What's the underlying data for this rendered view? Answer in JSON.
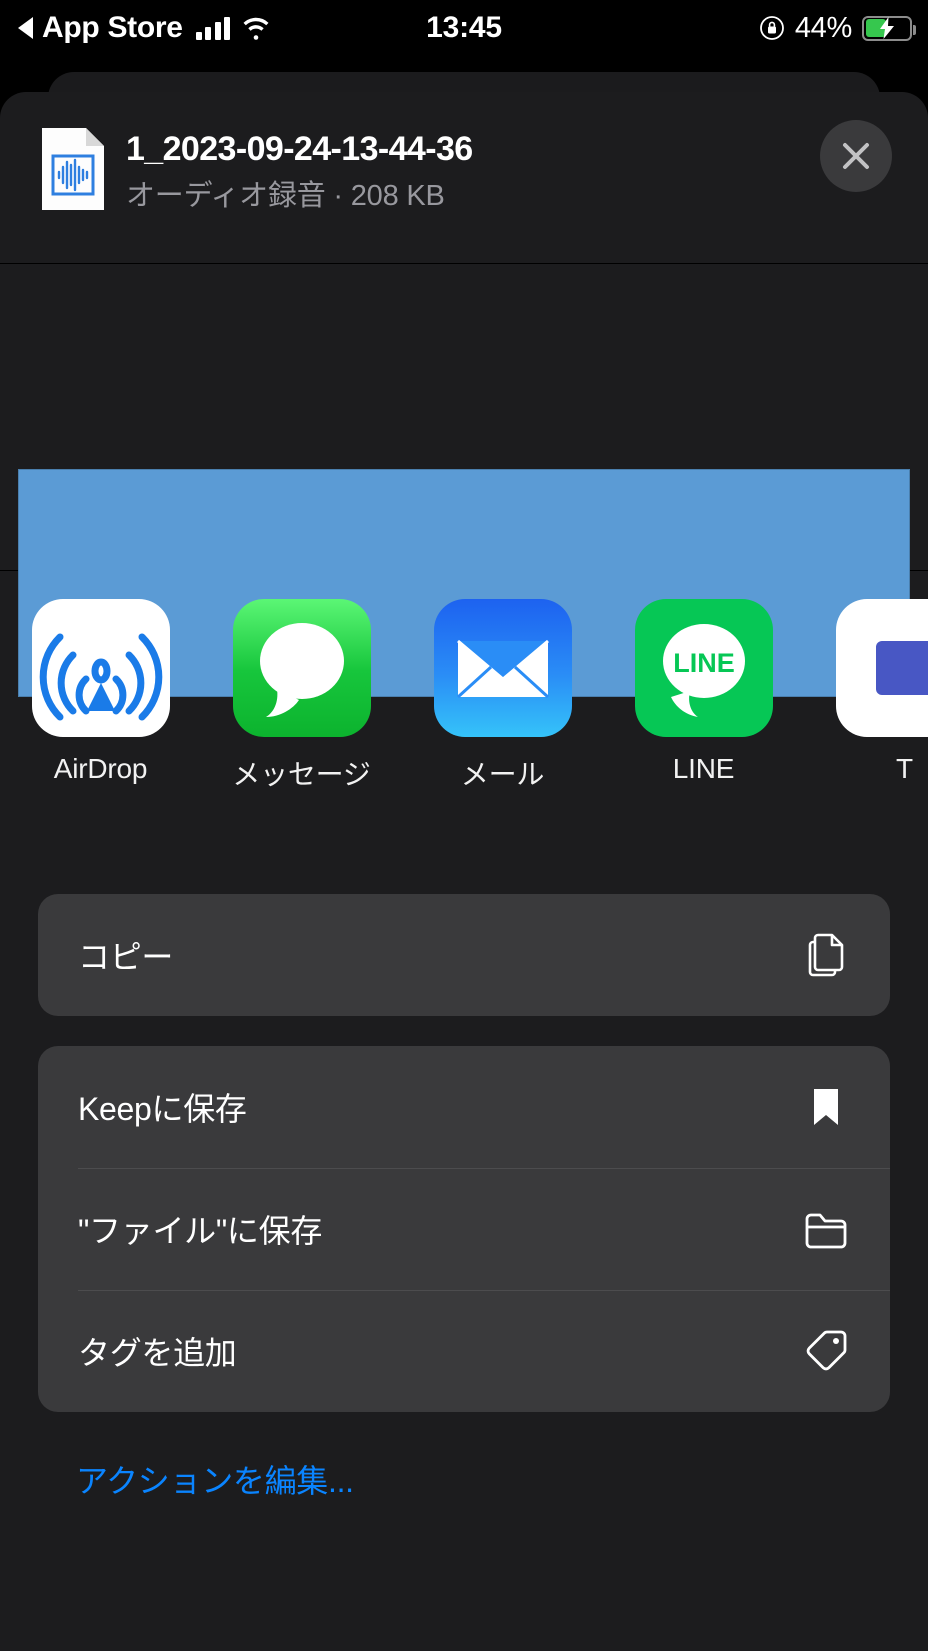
{
  "status_bar": {
    "back_arrow_icon": "triangle-left-icon",
    "carrier_app": "App Store",
    "signal_icon": "cellular-signal-icon",
    "wifi_icon": "wifi-icon",
    "time": "13:45",
    "rotation_lock_icon": "rotation-lock-icon",
    "battery_percent": "44%",
    "battery_icon": "battery-charging-icon",
    "battery_level": 44
  },
  "header": {
    "file_icon": "audio-document-icon",
    "title": "1_2023-09-24-13-44-36",
    "subtitle": "オーディオ録音 · 208 KB",
    "close_icon": "close-icon"
  },
  "preview": {
    "label": "audio-waveform-preview",
    "fill_color": "#5B9BD5",
    "border_color": "#4A7FAE"
  },
  "apps": [
    {
      "label": "AirDrop",
      "icon": "airdrop-icon"
    },
    {
      "label": "メッセージ",
      "icon": "messages-icon"
    },
    {
      "label": "メール",
      "icon": "mail-icon"
    },
    {
      "label": "LINE",
      "icon": "line-icon",
      "wordmark": "LINE"
    },
    {
      "label": "T",
      "icon": "twitter-icon"
    }
  ],
  "action_groups": [
    {
      "name": "copy-group",
      "rows": [
        {
          "label": "コピー",
          "icon": "copy-icon"
        }
      ]
    },
    {
      "name": "save-group",
      "rows": [
        {
          "label": "Keepに保存",
          "icon": "bookmark-icon"
        },
        {
          "label": "\"ファイル\"に保存",
          "icon": "folder-icon"
        },
        {
          "label": "タグを追加",
          "icon": "tag-icon"
        }
      ]
    }
  ],
  "edit_actions_label": "アクションを編集...",
  "colors": {
    "background": "#000000",
    "sheet": "#1C1C1E",
    "row": "#3A3A3C",
    "accent_blue": "#0A84FF",
    "battery_green": "#36C74E",
    "secondary_text": "#98989E"
  }
}
